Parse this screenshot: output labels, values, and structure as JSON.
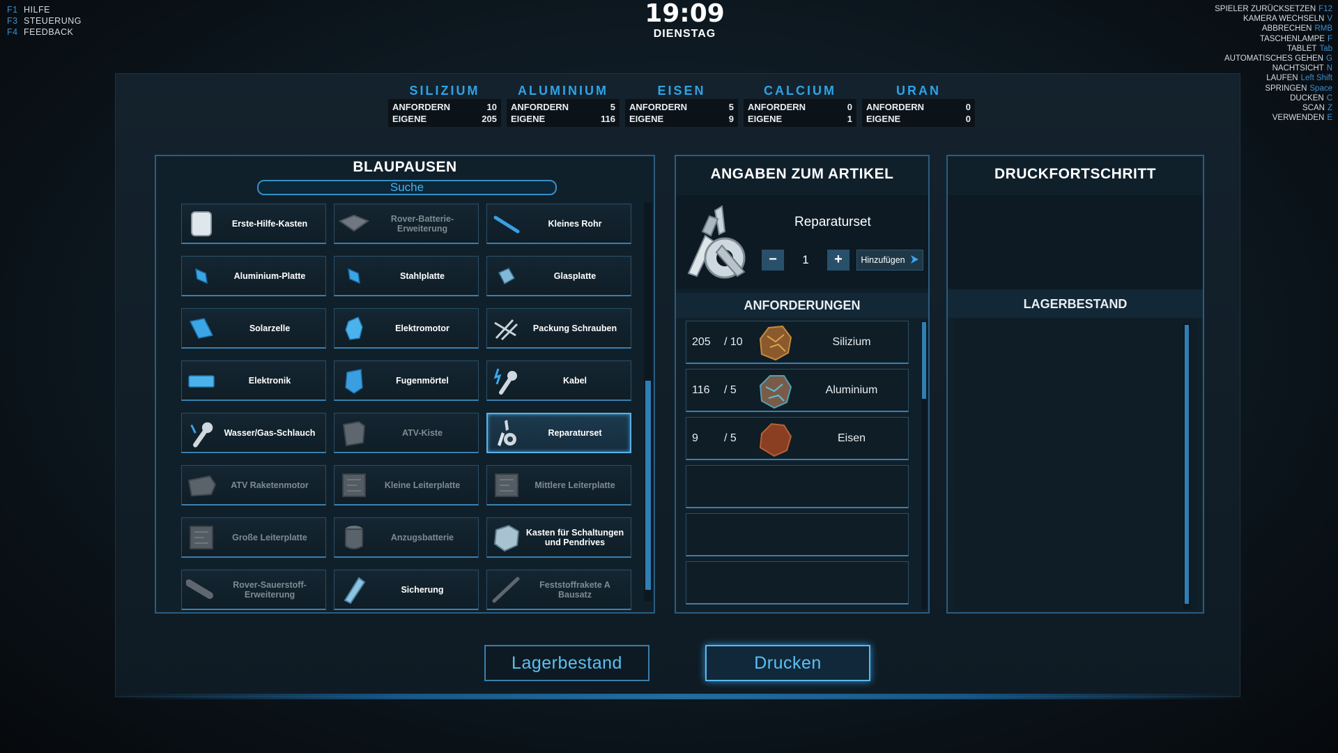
{
  "help": [
    {
      "key": "F1",
      "label": "HILFE"
    },
    {
      "key": "F3",
      "label": "STEUERUNG"
    },
    {
      "key": "F4",
      "label": "FEEDBACK"
    }
  ],
  "keybinds": [
    {
      "label": "SPIELER ZURÜCKSETZEN",
      "key": "F12"
    },
    {
      "label": "KAMERA WECHSELN",
      "key": "V"
    },
    {
      "label": "ABBRECHEN",
      "key": "RMB"
    },
    {
      "label": "TASCHENLAMPE",
      "key": "F"
    },
    {
      "label": "TABLET",
      "key": "Tab"
    },
    {
      "label": "AUTOMATISCHES GEHEN",
      "key": "G"
    },
    {
      "label": "NACHTSICHT",
      "key": "N"
    },
    {
      "label": "LAUFEN",
      "key": "Left Shift"
    },
    {
      "label": "SPRINGEN",
      "key": "Space"
    },
    {
      "label": "DUCKEN",
      "key": "C"
    },
    {
      "label": "SCAN",
      "key": "Z"
    },
    {
      "label": "VERWENDEN",
      "key": "E"
    }
  ],
  "clock": {
    "time": "19:09",
    "day": "DIENSTAG"
  },
  "resources": [
    {
      "name": "SILIZIUM",
      "request_label": "ANFORDERN",
      "request": "10",
      "own_label": "EIGENE",
      "own": "205"
    },
    {
      "name": "ALUMINIUM",
      "request_label": "ANFORDERN",
      "request": "5",
      "own_label": "EIGENE",
      "own": "116"
    },
    {
      "name": "EISEN",
      "request_label": "ANFORDERN",
      "request": "5",
      "own_label": "EIGENE",
      "own": "9"
    },
    {
      "name": "CALCIUM",
      "request_label": "ANFORDERN",
      "request": "0",
      "own_label": "EIGENE",
      "own": "1"
    },
    {
      "name": "URAN",
      "request_label": "ANFORDERN",
      "request": "0",
      "own_label": "EIGENE",
      "own": "0"
    }
  ],
  "blueprints": {
    "title": "BLAUPAUSEN",
    "search_label": "Suche",
    "items": [
      {
        "label": "Erste-Hilfe-Kasten",
        "icon": "first-aid-icon",
        "available": true
      },
      {
        "label": "Rover-Batterie-Erweiterung",
        "icon": "battery-icon",
        "available": false
      },
      {
        "label": "Kleines Rohr",
        "icon": "pipe-icon",
        "available": true
      },
      {
        "label": "Aluminium-Platte",
        "icon": "plate-icon",
        "available": true
      },
      {
        "label": "Stahlplatte",
        "icon": "plate-icon",
        "available": true
      },
      {
        "label": "Glasplatte",
        "icon": "glass-plate-icon",
        "available": true
      },
      {
        "label": "Solarzelle",
        "icon": "solar-cell-icon",
        "available": true
      },
      {
        "label": "Elektromotor",
        "icon": "motor-icon",
        "available": true
      },
      {
        "label": "Packung Schrauben",
        "icon": "screws-icon",
        "available": true
      },
      {
        "label": "Elektronik",
        "icon": "electronics-icon",
        "available": true
      },
      {
        "label": "Fugenmörtel",
        "icon": "grout-icon",
        "available": true
      },
      {
        "label": "Kabel",
        "icon": "cable-icon",
        "available": true
      },
      {
        "label": "Wasser/Gas-Schlauch",
        "icon": "hose-icon",
        "available": true
      },
      {
        "label": "ATV-Kiste",
        "icon": "crate-icon",
        "available": false
      },
      {
        "label": "Reparaturset",
        "icon": "repair-kit-icon",
        "available": true,
        "selected": true
      },
      {
        "label": "ATV Raketenmotor",
        "icon": "engine-icon",
        "available": false
      },
      {
        "label": "Kleine Leiterplatte",
        "icon": "circuit-board-icon",
        "available": false
      },
      {
        "label": "Mittlere Leiterplatte",
        "icon": "circuit-board-icon",
        "available": false
      },
      {
        "label": "Große Leiterplatte",
        "icon": "circuit-board-icon",
        "available": false
      },
      {
        "label": "Anzugsbatterie",
        "icon": "suit-battery-icon",
        "available": false
      },
      {
        "label": "Kasten für Schaltungen und Pendrives",
        "icon": "box-icon",
        "available": true
      },
      {
        "label": "Rover-Sauerstoff-Erweiterung",
        "icon": "oxygen-tank-icon",
        "available": false
      },
      {
        "label": "Sicherung",
        "icon": "fuse-icon",
        "available": true
      },
      {
        "label": "Feststoffrakete A Bausatz",
        "icon": "rocket-icon",
        "available": false
      }
    ]
  },
  "details": {
    "title": "ANGABEN ZUM ARTIKEL",
    "item_name": "Reparaturset",
    "minus_label": "−",
    "quantity": "1",
    "plus_label": "+",
    "add_label": "Hinzufügen",
    "requirements_title": "ANFORDERUNGEN",
    "requirements": [
      {
        "have": "205",
        "need": "/ 10",
        "name": "Silizium",
        "color": "#8a5a2c"
      },
      {
        "have": "116",
        "need": "/ 5",
        "name": "Aluminium",
        "color": "#7a5b48"
      },
      {
        "have": "9",
        "need": "/ 5",
        "name": "Eisen",
        "color": "#8a3e22"
      }
    ]
  },
  "print": {
    "title": "DRUCKFORTSCHRITT",
    "stock_title": "LAGERBESTAND"
  },
  "buttons": {
    "inventory": "Lagerbestand",
    "print": "Drucken"
  },
  "colors": {
    "accent": "#2fa3e6",
    "key": "#3d8ecf",
    "panel_border": "#2a5d80"
  }
}
